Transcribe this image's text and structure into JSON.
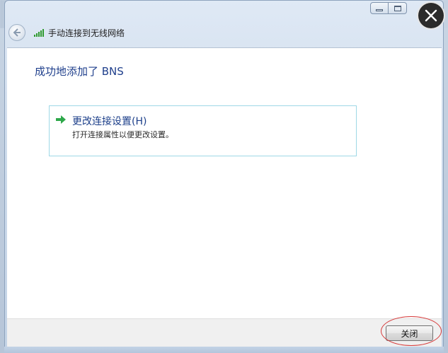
{
  "window": {
    "title": "手动连接到无线网络",
    "caption_buttons": {
      "minimize_icon": "minimize-icon",
      "maximize_icon": "maximize-icon",
      "close_icon": "close-x-icon"
    }
  },
  "content": {
    "heading": "成功地添加了 BNS",
    "tasks": [
      {
        "icon": "green-arrow-icon",
        "title": "更改连接设置(H)",
        "description": "打开连接属性以便更改设置。"
      }
    ]
  },
  "footer": {
    "close_label": "关闭"
  },
  "colors": {
    "heading": "#1f3f8c",
    "task_border": "#9ed8e6",
    "annotation": "#d63a3a",
    "signal": "#2f9a2f"
  }
}
